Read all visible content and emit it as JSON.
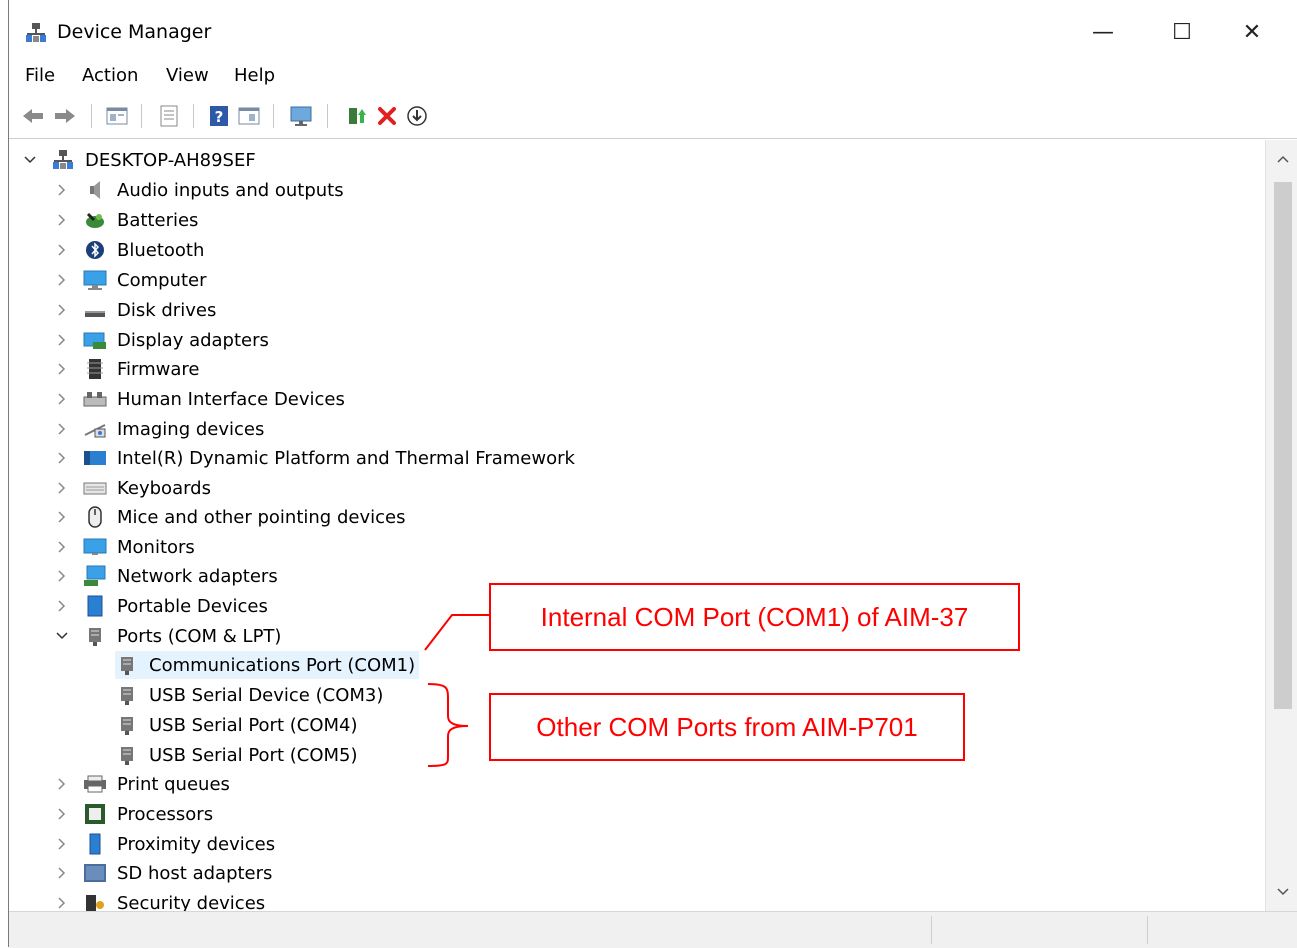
{
  "window": {
    "title": "Device Manager",
    "controls": {
      "minimize": "—",
      "maximize": "☐",
      "close": "✕"
    }
  },
  "menu": [
    "File",
    "Action",
    "View",
    "Help"
  ],
  "toolbar_icons": [
    "back-arrow-icon",
    "forward-arrow-icon",
    "properties-icon",
    "view-icon",
    "help-icon",
    "resources-icon",
    "monitor-scan-icon",
    "update-driver-icon",
    "uninstall-icon",
    "download-icon"
  ],
  "tree": {
    "root": "DESKTOP-AH89SEF",
    "categories": [
      {
        "label": "Audio inputs and outputs",
        "icon": "speaker-icon",
        "expanded": false
      },
      {
        "label": "Batteries",
        "icon": "battery-icon",
        "expanded": false
      },
      {
        "label": "Bluetooth",
        "icon": "bluetooth-icon",
        "expanded": false
      },
      {
        "label": "Computer",
        "icon": "computer-icon",
        "expanded": false
      },
      {
        "label": "Disk drives",
        "icon": "disk-drive-icon",
        "expanded": false
      },
      {
        "label": "Display adapters",
        "icon": "display-adapter-icon",
        "expanded": false
      },
      {
        "label": "Firmware",
        "icon": "firmware-icon",
        "expanded": false
      },
      {
        "label": "Human Interface Devices",
        "icon": "hid-icon",
        "expanded": false
      },
      {
        "label": "Imaging devices",
        "icon": "camera-icon",
        "expanded": false
      },
      {
        "label": "Intel(R) Dynamic Platform and Thermal Framework",
        "icon": "intel-dptf-icon",
        "expanded": false
      },
      {
        "label": "Keyboards",
        "icon": "keyboard-icon",
        "expanded": false
      },
      {
        "label": "Mice and other pointing devices",
        "icon": "mouse-icon",
        "expanded": false
      },
      {
        "label": "Monitors",
        "icon": "monitor-icon",
        "expanded": false
      },
      {
        "label": "Network adapters",
        "icon": "network-icon",
        "expanded": false
      },
      {
        "label": "Portable Devices",
        "icon": "portable-device-icon",
        "expanded": false
      },
      {
        "label": "Ports (COM & LPT)",
        "icon": "port-icon",
        "expanded": true,
        "children": [
          {
            "label": "Communications Port (COM1)",
            "selected": true
          },
          {
            "label": "USB Serial Device (COM3)",
            "selected": false
          },
          {
            "label": "USB Serial Port (COM4)",
            "selected": false
          },
          {
            "label": "USB Serial Port (COM5)",
            "selected": false
          }
        ]
      },
      {
        "label": "Print queues",
        "icon": "printer-icon",
        "expanded": false
      },
      {
        "label": "Processors",
        "icon": "processor-icon",
        "expanded": false
      },
      {
        "label": "Proximity devices",
        "icon": "proximity-icon",
        "expanded": false
      },
      {
        "label": "SD host adapters",
        "icon": "sd-adapter-icon",
        "expanded": false
      },
      {
        "label": "Security devices",
        "icon": "security-icon",
        "expanded": false
      }
    ]
  },
  "annotations": {
    "internal": "Internal COM Port (COM1) of AIM-37",
    "other": "Other COM Ports from AIM-P701"
  },
  "colors": {
    "annotation": "#ff0000",
    "selection": "#e5f3ff"
  }
}
